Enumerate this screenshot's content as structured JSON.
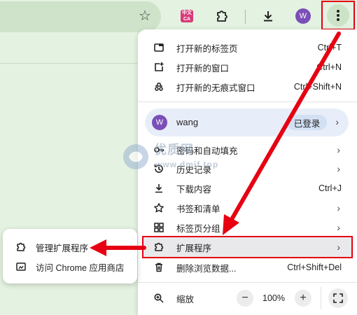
{
  "toolbar": {
    "ext_badge": "中文\nCA",
    "avatar_letter": "W"
  },
  "menu": {
    "items": [
      {
        "label": "打开新的标签页",
        "shortcut": "Ctrl+T"
      },
      {
        "label": "打开新的窗口",
        "shortcut": "Ctrl+N"
      },
      {
        "label": "打开新的无痕式窗口",
        "shortcut": "Ctrl+Shift+N"
      }
    ],
    "profile": {
      "avatar_letter": "W",
      "name": "wang",
      "status": "已登录"
    },
    "items2": [
      {
        "label": "密码和自动填充",
        "shortcut": ""
      },
      {
        "label": "历史记录",
        "shortcut": ""
      },
      {
        "label": "下载内容",
        "shortcut": "Ctrl+J"
      },
      {
        "label": "书签和清单",
        "shortcut": ""
      },
      {
        "label": "标签页分组",
        "shortcut": ""
      },
      {
        "label": "扩展程序",
        "shortcut": ""
      },
      {
        "label": "删除浏览数据...",
        "shortcut": "Ctrl+Shift+Del"
      }
    ],
    "zoom": {
      "label": "缩放",
      "value": "100%",
      "minus": "−",
      "plus": "+"
    }
  },
  "submenu": {
    "items": [
      {
        "label": "管理扩展程序"
      },
      {
        "label": "访问 Chrome 应用商店"
      }
    ]
  },
  "watermark": {
    "line1": "优质网",
    "line2": "www.dmif.top"
  },
  "colors": {
    "highlight_red": "#e60012",
    "avatar": "#7a4fb7",
    "page_bg": "#e4f2e1"
  }
}
